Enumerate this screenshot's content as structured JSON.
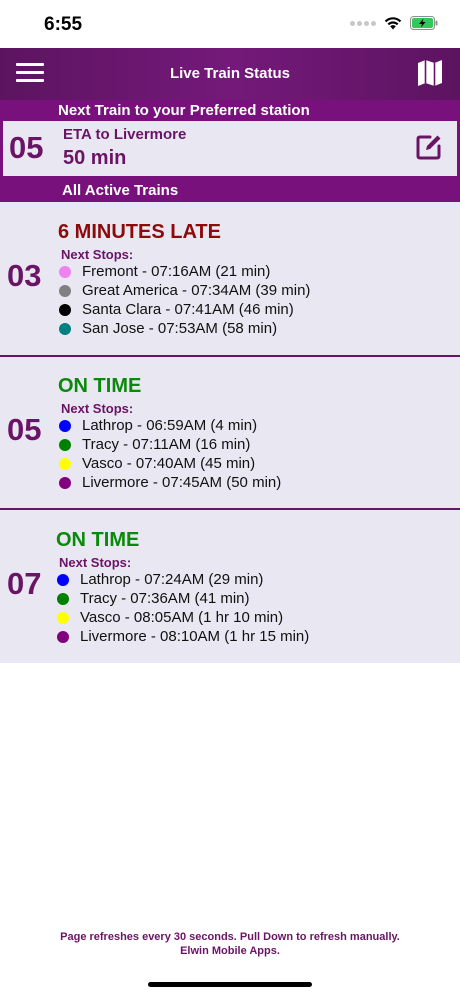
{
  "status_bar": {
    "time": "6:55"
  },
  "navbar": {
    "title": "Live Train Status",
    "menu_icon": "hamburger-menu-icon",
    "map_icon": "map-icon"
  },
  "preferred": {
    "header": "Next Train to your Preferred station",
    "train_number": "05",
    "eta_label": "ETA to Livermore",
    "eta_value": "50 min",
    "edit_icon": "edit-icon"
  },
  "active_header": "All Active Trains",
  "next_stops_label": "Next Stops:",
  "trains": [
    {
      "number": "03",
      "status": "6 MINUTES LATE",
      "status_color": "#8b0a0a",
      "stops": [
        {
          "text": "Fremont - 07:16AM (21 min)",
          "color": "#ee82ee"
        },
        {
          "text": "Great America - 07:34AM (39 min)",
          "color": "#808080"
        },
        {
          "text": "Santa Clara - 07:41AM (46 min)",
          "color": "#000000"
        },
        {
          "text": "San Jose - 07:53AM (58 min)",
          "color": "#008080"
        }
      ]
    },
    {
      "number": "05",
      "status": "ON TIME",
      "status_color": "#0a8a0a",
      "stops": [
        {
          "text": "Lathrop - 06:59AM (4 min)",
          "color": "#0000ff"
        },
        {
          "text": "Tracy - 07:11AM (16 min)",
          "color": "#008000"
        },
        {
          "text": "Vasco - 07:40AM (45 min)",
          "color": "#ffff00"
        },
        {
          "text": "Livermore - 07:45AM (50 min)",
          "color": "#800080"
        }
      ]
    },
    {
      "number": "07",
      "status": "ON TIME",
      "status_color": "#0a8a0a",
      "stops": [
        {
          "text": "Lathrop - 07:24AM (29 min)",
          "color": "#0000ff"
        },
        {
          "text": "Tracy - 07:36AM (41 min)",
          "color": "#008000"
        },
        {
          "text": "Vasco - 08:05AM (1 hr 10 min)",
          "color": "#ffff00"
        },
        {
          "text": "Livermore - 08:10AM (1 hr 15 min)",
          "color": "#800080"
        }
      ]
    }
  ],
  "footer": {
    "line1": "Page refreshes every 30 seconds. Pull Down to refresh manually.",
    "line2": "Elwin Mobile Apps."
  }
}
